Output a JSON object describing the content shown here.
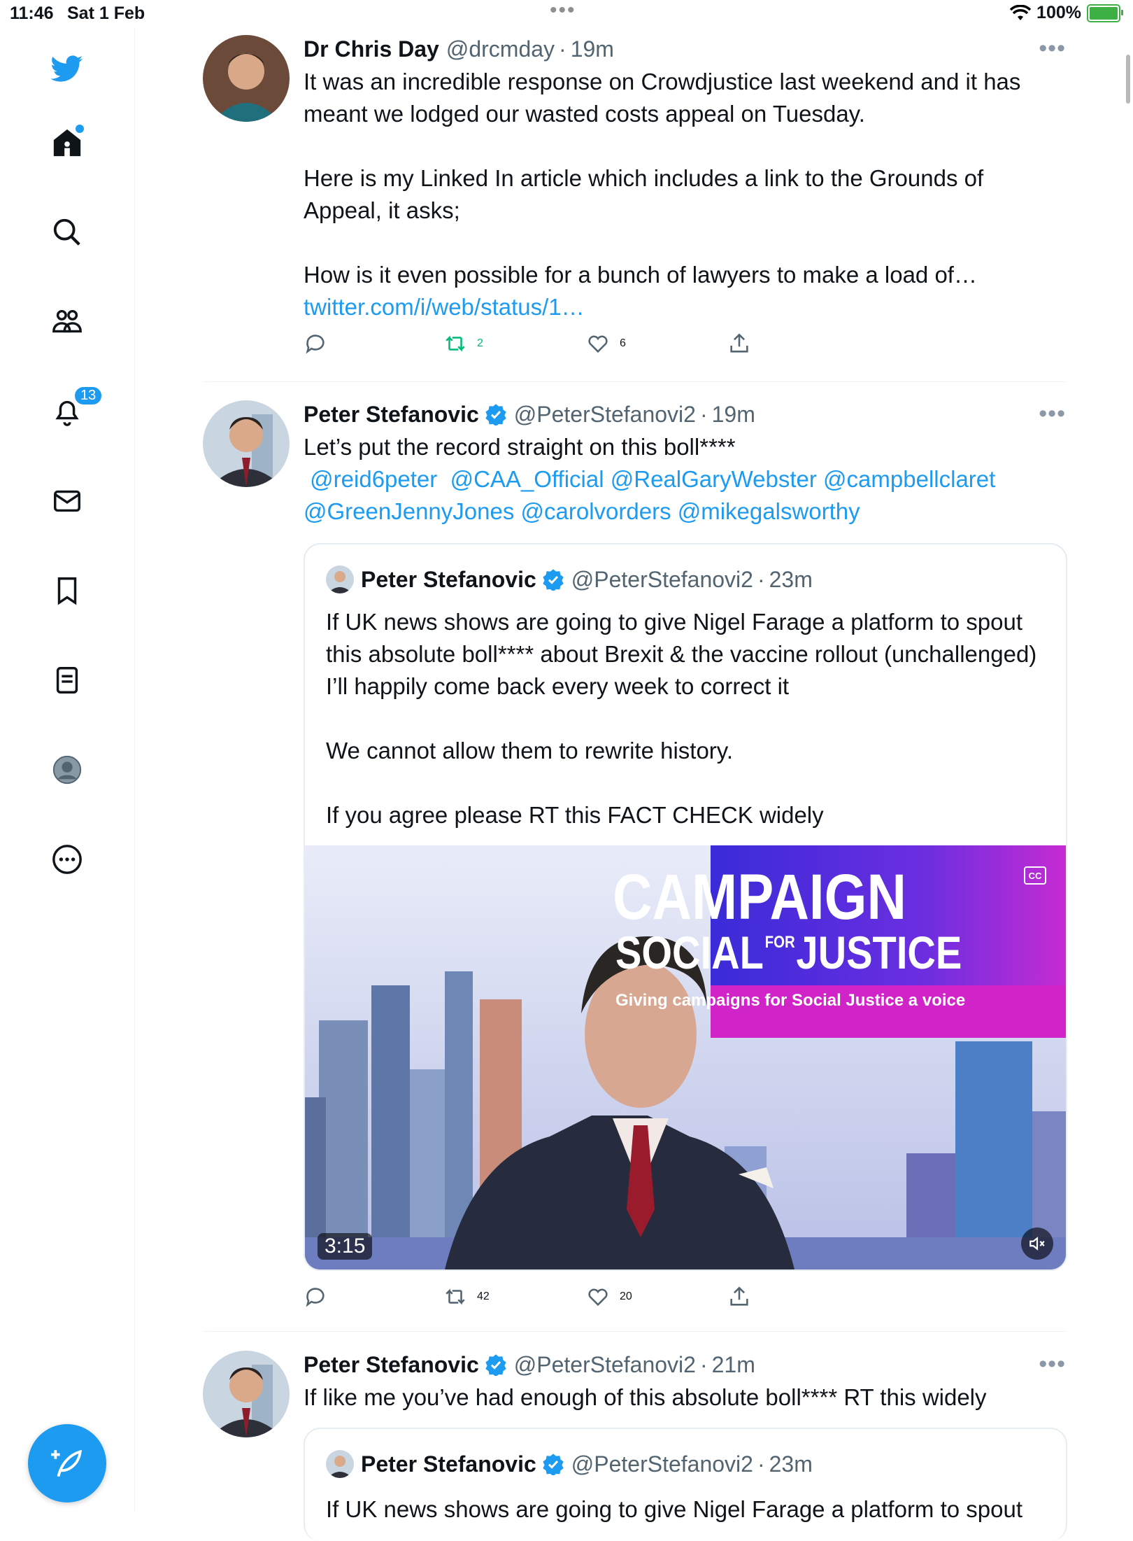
{
  "status_bar": {
    "time": "11:46",
    "date": "Sat 1 Feb",
    "battery": "100%"
  },
  "sidebar": {
    "notifications_count": "13",
    "items": [
      "twitter-logo",
      "home-icon",
      "search-icon",
      "communities-icon",
      "notifications-icon",
      "messages-icon",
      "bookmarks-icon",
      "lists-icon",
      "profile-icon",
      "more-icon"
    ]
  },
  "tweets": [
    {
      "name": "Dr Chris Day",
      "handle": "@drcmday",
      "sep": "·",
      "time": "19m",
      "text": [
        "It was an incredible response on Crowdjustice last weekend and it has meant we lodged our wasted costs appeal on Tuesday.",
        "Here is my Linked In article which includes a link to the Grounds of Appeal, it asks;",
        "How is it even possible for a bunch of lawyers to make a load of…"
      ],
      "link": "twitter.com/i/web/status/1…",
      "retweets": "2",
      "likes": "6"
    },
    {
      "name": "Peter Stefanovic",
      "handle": "@PeterStefanovi2",
      "sep": "·",
      "time": "19m",
      "text": "Let’s put the record straight on this boll****",
      "mentions": " @reid6peter  @CAA_Official @RealGaryWebster @campbellclaret @GreenJennyJones @carolvorders @mikegalsworthy",
      "quote": {
        "name": "Peter Stefanovic",
        "handle": "@PeterStefanovi2",
        "sep": "·",
        "time": "23m",
        "text": [
          "If UK news shows are going to give Nigel Farage a platform to spout this absolute boll**** about Brexit & the vaccine rollout (unchallenged) I’ll happily come back every week to correct it",
          "We cannot allow them to rewrite history.",
          "If you agree please RT this FACT CHECK widely"
        ],
        "video": {
          "duration": "3:15",
          "banner_line1": "CAMPAIGN",
          "banner_line2a": "SOCIAL",
          "banner_line2b": "FOR",
          "banner_line2c": "JUSTICE",
          "banner_tagline": "Giving campaigns for Social Justice a voice",
          "cc": "CC"
        }
      },
      "retweets": "42",
      "likes": "20"
    },
    {
      "name": "Peter Stefanovic",
      "handle": "@PeterStefanovi2",
      "sep": "·",
      "time": "21m",
      "text": "If like me you’ve had enough of this absolute boll**** RT this widely",
      "quote": {
        "name": "Peter Stefanovic",
        "handle": "@PeterStefanovi2",
        "sep": "·",
        "time": "23m",
        "text": "If UK news shows are going to give Nigel Farage a platform to spout"
      }
    }
  ],
  "colors": {
    "accent": "#1d9bf0",
    "retweet_active": "#00ba7c",
    "muted": "#536471"
  }
}
